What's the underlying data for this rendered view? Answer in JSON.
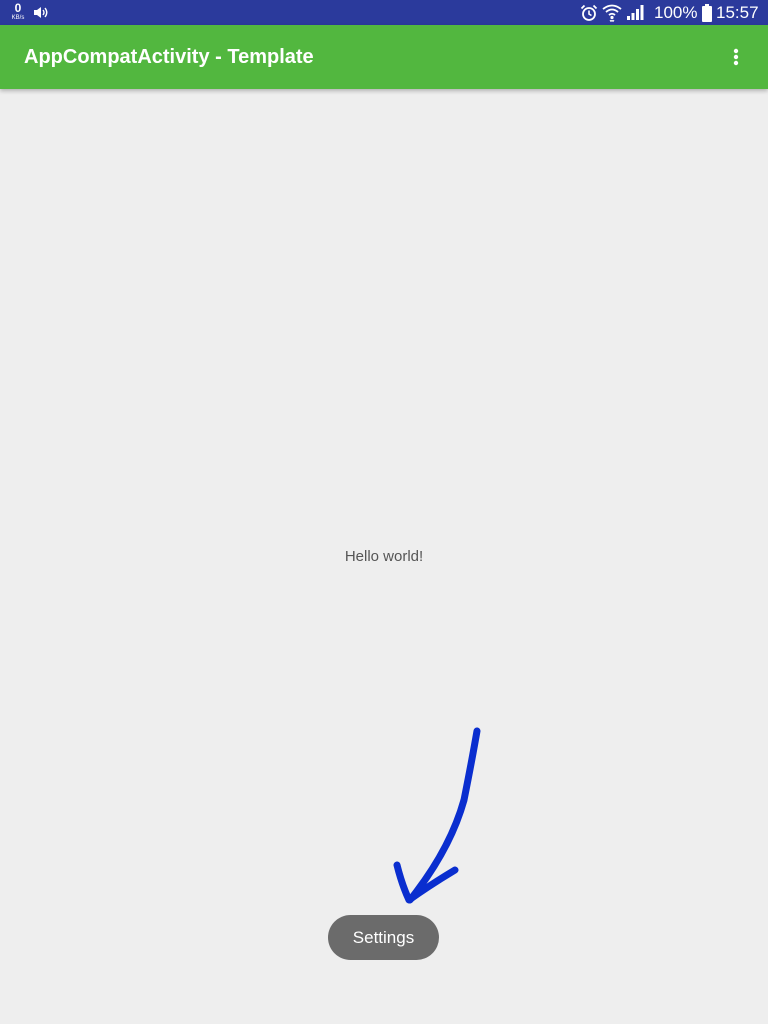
{
  "status_bar": {
    "net_speed_value": "0",
    "net_speed_unit": "KB/s",
    "volume_icon": "speaker-icon",
    "alarm_icon": "alarm-clock-icon",
    "wifi_icon": "wifi-icon",
    "signal_icon": "cell-signal-icon",
    "battery_percent": "100%",
    "battery_icon": "battery-icon",
    "time": "15:57",
    "background_color": "#2b3a9c"
  },
  "app_bar": {
    "title": "AppCompatActivity - Template",
    "overflow_icon": "more-vert-icon",
    "background_color": "#52b73f"
  },
  "content": {
    "hello_text": "Hello world!"
  },
  "annotation": {
    "arrow_icon": "hand-drawn-arrow-icon",
    "color": "#0a2ecf"
  },
  "toast": {
    "label": "Settings",
    "background_color": "#6b6b6b"
  }
}
